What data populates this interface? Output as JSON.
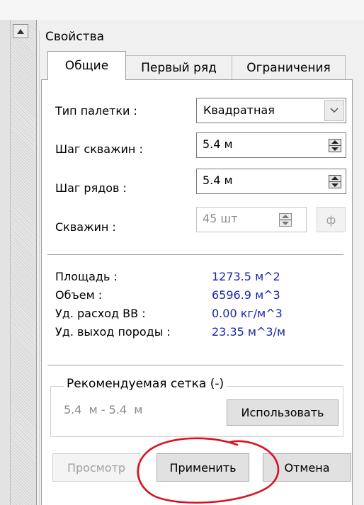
{
  "panel": {
    "title": "Свойства",
    "tabs": [
      {
        "label": "Общие",
        "active": true
      },
      {
        "label": "Первый ряд",
        "active": false
      },
      {
        "label": "Ограничения",
        "active": false
      }
    ]
  },
  "fields": {
    "palette_type": {
      "label": "Тип палетки :",
      "value": "Квадратная"
    },
    "well_spacing": {
      "label": "Шаг скважин :",
      "value": "5.4 м"
    },
    "row_spacing": {
      "label": "Шаг рядов :",
      "value": "5.4 м"
    },
    "wells": {
      "label": "Скважин :",
      "value": "45 шт",
      "button": "ф"
    }
  },
  "stats": [
    {
      "label": "Площадь :",
      "value": "1273.5 м^2"
    },
    {
      "label": "Объем :",
      "value": "6596.9 м^3"
    },
    {
      "label": "Уд. расход ВВ :",
      "value": "0.00 кг/м^3"
    },
    {
      "label": "Уд. выход породы :",
      "value": "23.35 м^3/м"
    }
  ],
  "recommended": {
    "title": "Рекомендуемая сетка (-)",
    "value": "5.4  м - 5.4  м",
    "use_button": "Использовать"
  },
  "buttons": {
    "preview": "Просмотр",
    "apply": "Применить",
    "cancel": "Отмена"
  },
  "colors": {
    "value_text": "#1a26a8",
    "annotation": "#d9121e",
    "disabled_text": "#8a8a8a"
  }
}
